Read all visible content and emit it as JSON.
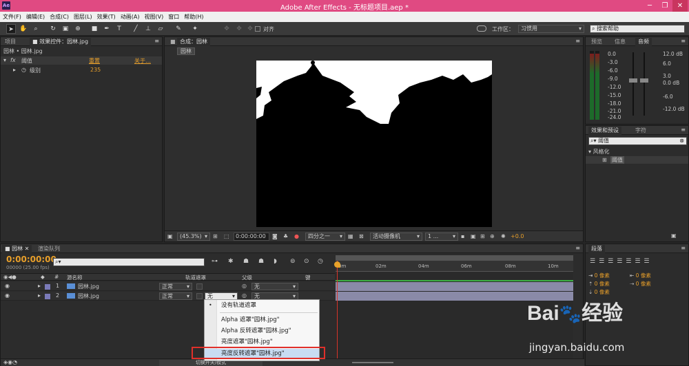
{
  "app": {
    "title": "Adobe After Effects - 无标题项目.aep *",
    "logo": "Ae"
  },
  "menu": [
    "文件(F)",
    "编辑(E)",
    "合成(C)",
    "图层(L)",
    "效果(T)",
    "动画(A)",
    "视图(V)",
    "窗口",
    "帮助(H)"
  ],
  "toolbar": {
    "snap_label": "对齐",
    "workspace_label": "工作区：",
    "workspace_value": "习惯用",
    "search_placeholder": "搜索帮助"
  },
  "left_panel": {
    "tab_project": "项目",
    "tab_effects": "效果控件：园林.jpg",
    "breadcrumb": "园林 • 园林.jpg",
    "effect_name": "阈值",
    "reset": "重置",
    "about": "关于…",
    "param_label": "级别",
    "param_value": "235"
  },
  "comp_panel": {
    "tab": "合成：园林",
    "comp_chip": "园林",
    "zoom": "(45.3%)",
    "time": "0:00:00:00",
    "resolution": "四分之一",
    "camera": "活动摄像机",
    "views": "1 ...",
    "exposure": "+0.0"
  },
  "audio_panel": {
    "tabs": [
      "预览",
      "信息",
      "音频"
    ],
    "db_left": [
      "0.0",
      "-3.0",
      "-6.0",
      "-9.0",
      "-12.0",
      "-15.0",
      "-18.0",
      "-21.0",
      "-24.0"
    ],
    "db_right": [
      "12.0 dB",
      "6.0",
      "3.0",
      "0.0 dB",
      "-6.0",
      "-12.0 dB"
    ]
  },
  "effects_panel": {
    "tabs": [
      "效果和预设",
      "字符"
    ],
    "search_value": "阈值",
    "category": "风格化",
    "item": "阈值"
  },
  "paragraph_panel": {
    "tab": "段落",
    "indent_values": [
      "0 像素",
      "0 像素",
      "0 像素",
      "0 像素",
      "0 像素"
    ]
  },
  "timeline": {
    "tab_comp": "园林",
    "tab_render": "渲染队列",
    "timecode": "0:00:00:00",
    "fps": "00000 (25.00 fps)",
    "col_num": "#",
    "col_source": "源名称",
    "col_trackmatte": "轨道遮罩",
    "col_parent": "父级",
    "col_key": "键",
    "ruler": [
      "0m",
      "02m",
      "04m",
      "06m",
      "08m",
      "10m"
    ],
    "layers": [
      {
        "num": "1",
        "name": "园林.jpg",
        "mode": "正常",
        "matte": "",
        "parent": "无"
      },
      {
        "num": "2",
        "name": "园林.jpg",
        "mode": "正常",
        "matte": "无",
        "parent": "无"
      }
    ],
    "footer_label": "切换开关/模式"
  },
  "matte_menu": {
    "items": [
      "没有轨道遮罩",
      "Alpha 遮罩\"园林.jpg\"",
      "Alpha 反转遮罩\"园林.jpg\"",
      "亮度遮罩\"园林.jpg\"",
      "亮度反转遮罩\"园林.jpg\""
    ]
  },
  "watermark": {
    "brand": "Bai",
    "brand2": "经验",
    "url": "jingyan.baidu.com"
  }
}
